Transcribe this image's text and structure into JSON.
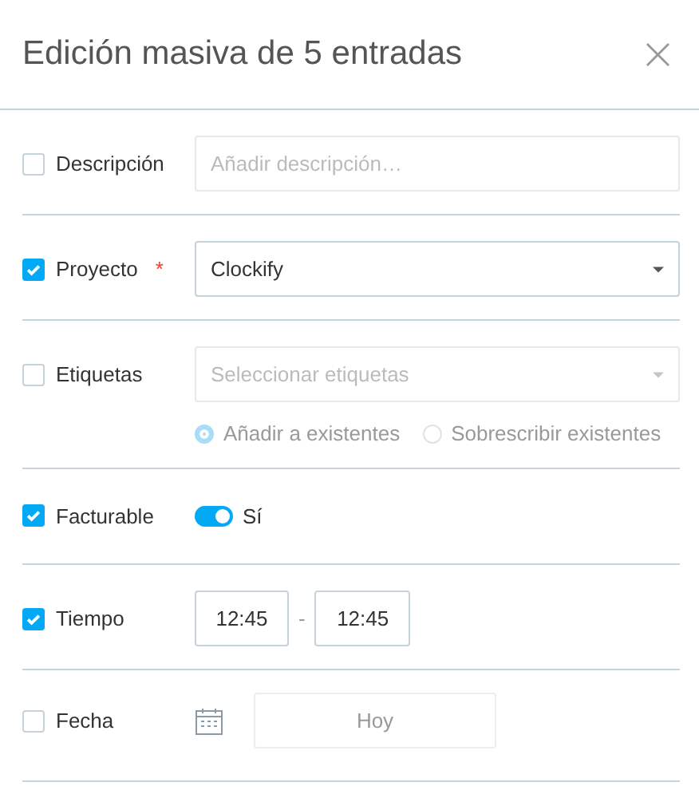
{
  "dialog": {
    "title": "Edición masiva de 5 entradas",
    "close": "×"
  },
  "rows": [
    {
      "kind": "text",
      "label": "Descripción",
      "checked": false,
      "placeholder": "Añadir descripción…"
    },
    {
      "kind": "select",
      "label": "Proyecto",
      "checked": true,
      "required_mark": "*",
      "value": "Clockify"
    },
    {
      "kind": "tags",
      "label": "Etiquetas",
      "checked": false,
      "placeholder": "Seleccionar etiquetas",
      "disabled": true,
      "options": [
        {
          "label": "Añadir a existentes",
          "selected": true
        },
        {
          "label": "Sobrescribir existentes",
          "selected": false
        }
      ]
    },
    {
      "kind": "toggle",
      "label": "Facturable",
      "checked": true,
      "on": true,
      "text": "Sí"
    },
    {
      "kind": "time",
      "label": "Tiempo",
      "checked": true,
      "start": "12:45",
      "separator": "-",
      "end": "12:45"
    },
    {
      "kind": "date",
      "label": "Fecha",
      "checked": false,
      "disabled": true,
      "value": "Hoy"
    }
  ]
}
